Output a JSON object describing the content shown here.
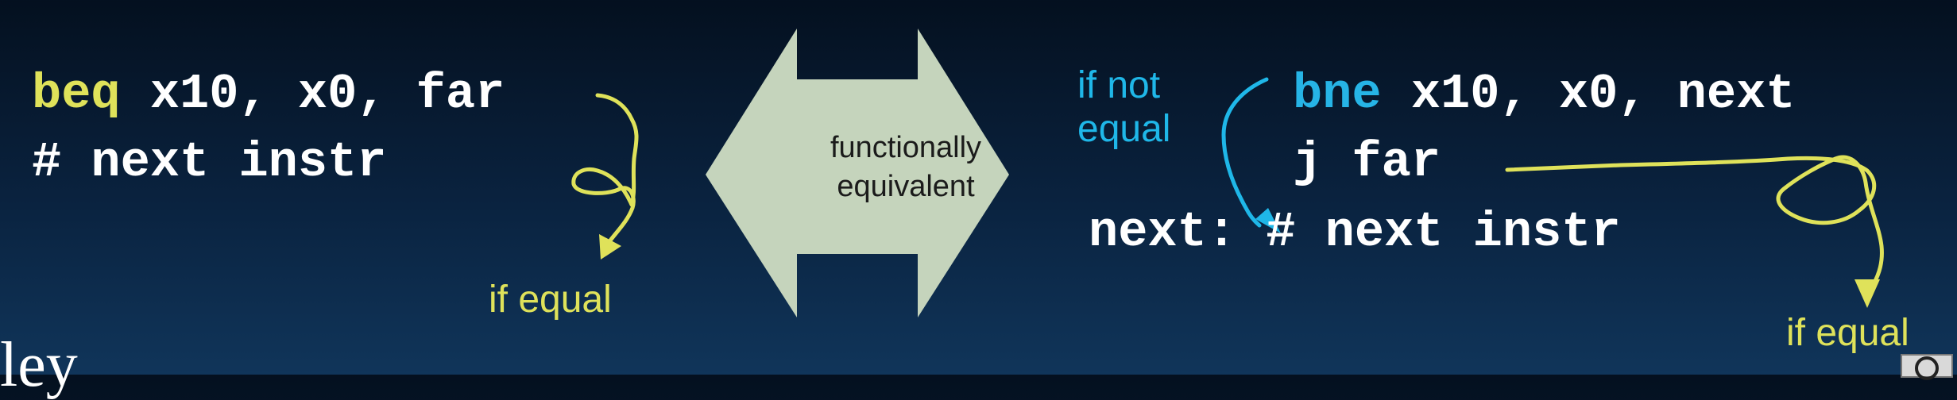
{
  "left_code": {
    "line1_keyword": "beq",
    "line1_rest": " x10, x0, far",
    "line2": "# next instr",
    "label_if_equal": "if equal"
  },
  "center": {
    "line1": "functionally",
    "line2": "equivalent"
  },
  "right_code": {
    "label_if_not_line1": "if not",
    "label_if_not_line2": "equal",
    "line1_keyword": "bne",
    "line1_rest": " x10, x0, next",
    "line2": "j far",
    "line3_label": "next:",
    "line3_rest": " # next instr",
    "label_if_equal": "if equal"
  },
  "colors": {
    "yellow": "#dfe25a",
    "cyan": "#1fb7e8",
    "arrow_fill": "#c5d4bc"
  },
  "icons": {
    "double_arrow": "double-headed-arrow-icon",
    "badge": "creative-commons-badge-icon"
  }
}
